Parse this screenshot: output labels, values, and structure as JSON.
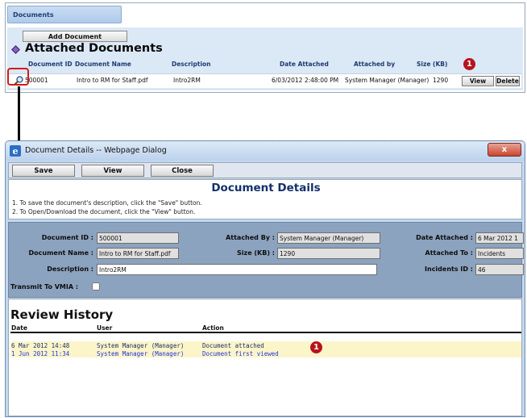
{
  "colors": {
    "badge": "#b8121b",
    "highlight_box": "#d11b1b",
    "title_blue": "#13306b",
    "row_highlight": "#fbf5c9"
  },
  "top_panel": {
    "tab_label": "Documents",
    "add_button": "Add Document",
    "section_title": "Attached Documents",
    "columns": [
      "Document ID",
      "Document Name",
      "Description",
      "Date Attached",
      "Attached by",
      "Size (KB)"
    ],
    "row": {
      "document_id": "500001",
      "document_name": "Intro to RM for Staff.pdf",
      "description": "Intro2RM",
      "date_attached": "6/03/2012 2:48:00 PM",
      "attached_by": "System Manager (Manager)",
      "size_kb": "1290",
      "view_button": "View",
      "delete_button": "Delete"
    },
    "badge": "1"
  },
  "dialog": {
    "title": "Document Details -- Webpage Dialog",
    "close_glyph": "x",
    "toolbar": {
      "save": "Save",
      "view": "View",
      "close": "Close"
    },
    "heading": "Document Details",
    "instructions": [
      "1.  To save the document's description, click the \"Save\" button.",
      "2.  To Open/Download the document, click the  \"View\" button."
    ],
    "form": {
      "document_id_label": "Document ID :",
      "document_id": "500001",
      "attached_by_label": "Attached By :",
      "attached_by": "System Manager (Manager)",
      "date_attached_label": "Date Attached :",
      "date_attached": "6 Mar 2012 1",
      "document_name_label": "Document Name :",
      "document_name": "Intro to RM for Staff.pdf",
      "size_label": "Size (KB) :",
      "size": "1290",
      "attached_to_label": "Attached To :",
      "attached_to": "Incidents",
      "description_label": "Description :",
      "description": "Intro2RM",
      "incidents_id_label": "Incidents ID :",
      "incidents_id": "46",
      "vmia_label": "Transmit To VMIA :"
    },
    "history": {
      "title": "Review History",
      "columns": [
        "Date",
        "User",
        "Action"
      ],
      "rows": [
        {
          "date": "6 Mar 2012 14:48",
          "user": "System Manager (Manager)",
          "action": "Document attached"
        },
        {
          "date": "1 Jun 2012 11:34",
          "user": "System Manager (Manager)",
          "action": "Document first viewed"
        }
      ],
      "badge": "1"
    }
  }
}
